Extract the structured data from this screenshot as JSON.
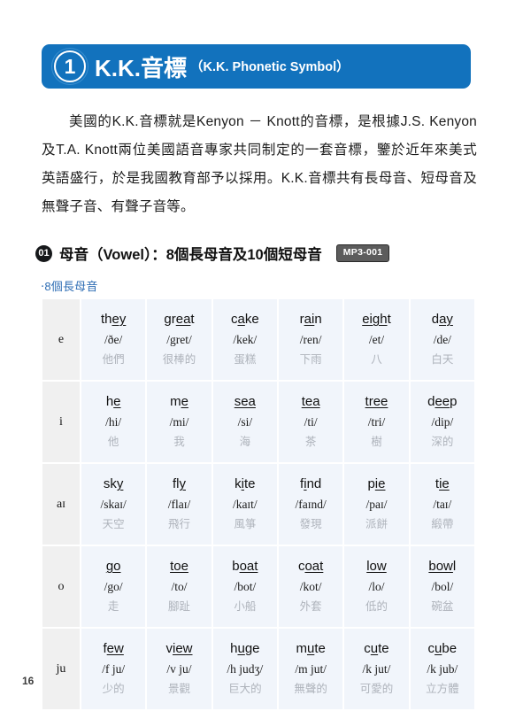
{
  "banner": {
    "number": "1",
    "title": "K.K.音標",
    "subtitle": "（K.K. Phonetic Symbol）",
    "color": "#1272bd"
  },
  "intro": {
    "paragraph": "美國的K.K.音標就是Kenyon － Knott的音標，是根據J.S. Kenyon及T.A. Knott兩位美國語音專家共同制定的一套音標，鑒於近年來美式英語盛行，於是我國教育部予以採用。K.K.音標共有長母音、短母音及無聲子音、有聲子音等。"
  },
  "section": {
    "bullet": "01",
    "title": "母音（Vowel）：8個長母音及10個短母音",
    "mp3_badge": "MP3-001",
    "sub_label": "‧8個長母音",
    "sub_label_color": "#2e6db4"
  },
  "table": {
    "rows": [
      {
        "symbol": "e",
        "cells": [
          {
            "word_pre": "th",
            "word_mark": "ey",
            "word_post": "",
            "ipa": "/ðe/",
            "gloss": "他們"
          },
          {
            "word_pre": "gr",
            "word_mark": "ea",
            "word_post": "t",
            "ipa": "/gret/",
            "gloss": "很棒的"
          },
          {
            "word_pre": "c",
            "word_mark": "a",
            "word_post": "ke",
            "ipa": "/kek/",
            "gloss": "蛋糕"
          },
          {
            "word_pre": "r",
            "word_mark": "ai",
            "word_post": "n",
            "ipa": "/ren/",
            "gloss": "下雨"
          },
          {
            "word_pre": "",
            "word_mark": "eigh",
            "word_post": "t",
            "ipa": "/et/",
            "gloss": "八"
          },
          {
            "word_pre": "d",
            "word_mark": "ay",
            "word_post": "",
            "ipa": "/de/",
            "gloss": "白天"
          }
        ]
      },
      {
        "symbol": "i",
        "cells": [
          {
            "word_pre": "h",
            "word_mark": "e",
            "word_post": "",
            "ipa": "/hi/",
            "gloss": "他"
          },
          {
            "word_pre": "m",
            "word_mark": "e",
            "word_post": "",
            "ipa": "/mi/",
            "gloss": "我"
          },
          {
            "word_pre": "",
            "word_mark": "sea",
            "word_post": "",
            "ipa": "/si/",
            "gloss": "海"
          },
          {
            "word_pre": "",
            "word_mark": "tea",
            "word_post": "",
            "ipa": "/ti/",
            "gloss": "茶"
          },
          {
            "word_pre": "",
            "word_mark": "tree",
            "word_post": "",
            "ipa": "/tri/",
            "gloss": "樹"
          },
          {
            "word_pre": "d",
            "word_mark": "ee",
            "word_post": "p",
            "ipa": "/dip/",
            "gloss": "深的"
          }
        ]
      },
      {
        "symbol": "aɪ",
        "cells": [
          {
            "word_pre": "sk",
            "word_mark": "y",
            "word_post": "",
            "ipa": "/skaɪ/",
            "gloss": "天空"
          },
          {
            "word_pre": "fl",
            "word_mark": "y",
            "word_post": "",
            "ipa": "/flaɪ/",
            "gloss": "飛行"
          },
          {
            "word_pre": "k",
            "word_mark": "i",
            "word_post": "te",
            "ipa": "/kaɪt/",
            "gloss": "風箏"
          },
          {
            "word_pre": "f",
            "word_mark": "i",
            "word_post": "nd",
            "ipa": "/faɪnd/",
            "gloss": "發現"
          },
          {
            "word_pre": "p",
            "word_mark": "ie",
            "word_post": "",
            "ipa": "/paɪ/",
            "gloss": "派餅"
          },
          {
            "word_pre": "t",
            "word_mark": "ie",
            "word_post": "",
            "ipa": "/taɪ/",
            "gloss": "緞帶"
          }
        ]
      },
      {
        "symbol": "o",
        "cells": [
          {
            "word_pre": "",
            "word_mark": "go",
            "word_post": "",
            "ipa": "/go/",
            "gloss": "走"
          },
          {
            "word_pre": "",
            "word_mark": "toe",
            "word_post": "",
            "ipa": "/to/",
            "gloss": "腳趾"
          },
          {
            "word_pre": "b",
            "word_mark": "oat",
            "word_post": "",
            "ipa": "/bot/",
            "gloss": "小船"
          },
          {
            "word_pre": "c",
            "word_mark": "oat",
            "word_post": "",
            "ipa": "/kot/",
            "gloss": "外套"
          },
          {
            "word_pre": "",
            "word_mark": "low",
            "word_post": "",
            "ipa": "/lo/",
            "gloss": "低的"
          },
          {
            "word_pre": "",
            "word_mark": "bow",
            "word_post": "l",
            "ipa": "/bol/",
            "gloss": "碗盆"
          }
        ]
      },
      {
        "symbol": "ju",
        "cells": [
          {
            "word_pre": "f",
            "word_mark": "ew",
            "word_post": "",
            "ipa": "/f ju/",
            "gloss": "少的"
          },
          {
            "word_pre": "v",
            "word_mark": "iew",
            "word_post": "",
            "ipa": "/v ju/",
            "gloss": "景觀"
          },
          {
            "word_pre": "h",
            "word_mark": "u",
            "word_post": "ge",
            "ipa": "/h judʒ/",
            "gloss": "巨大的"
          },
          {
            "word_pre": "m",
            "word_mark": "u",
            "word_post": "te",
            "ipa": "/m jut/",
            "gloss": "無聲的"
          },
          {
            "word_pre": "c",
            "word_mark": "u",
            "word_post": "te",
            "ipa": "/k jut/",
            "gloss": "可愛的"
          },
          {
            "word_pre": "c",
            "word_mark": "u",
            "word_post": "be",
            "ipa": "/k jub/",
            "gloss": "立方體"
          }
        ]
      }
    ]
  },
  "footer": {
    "page_number": "16"
  }
}
